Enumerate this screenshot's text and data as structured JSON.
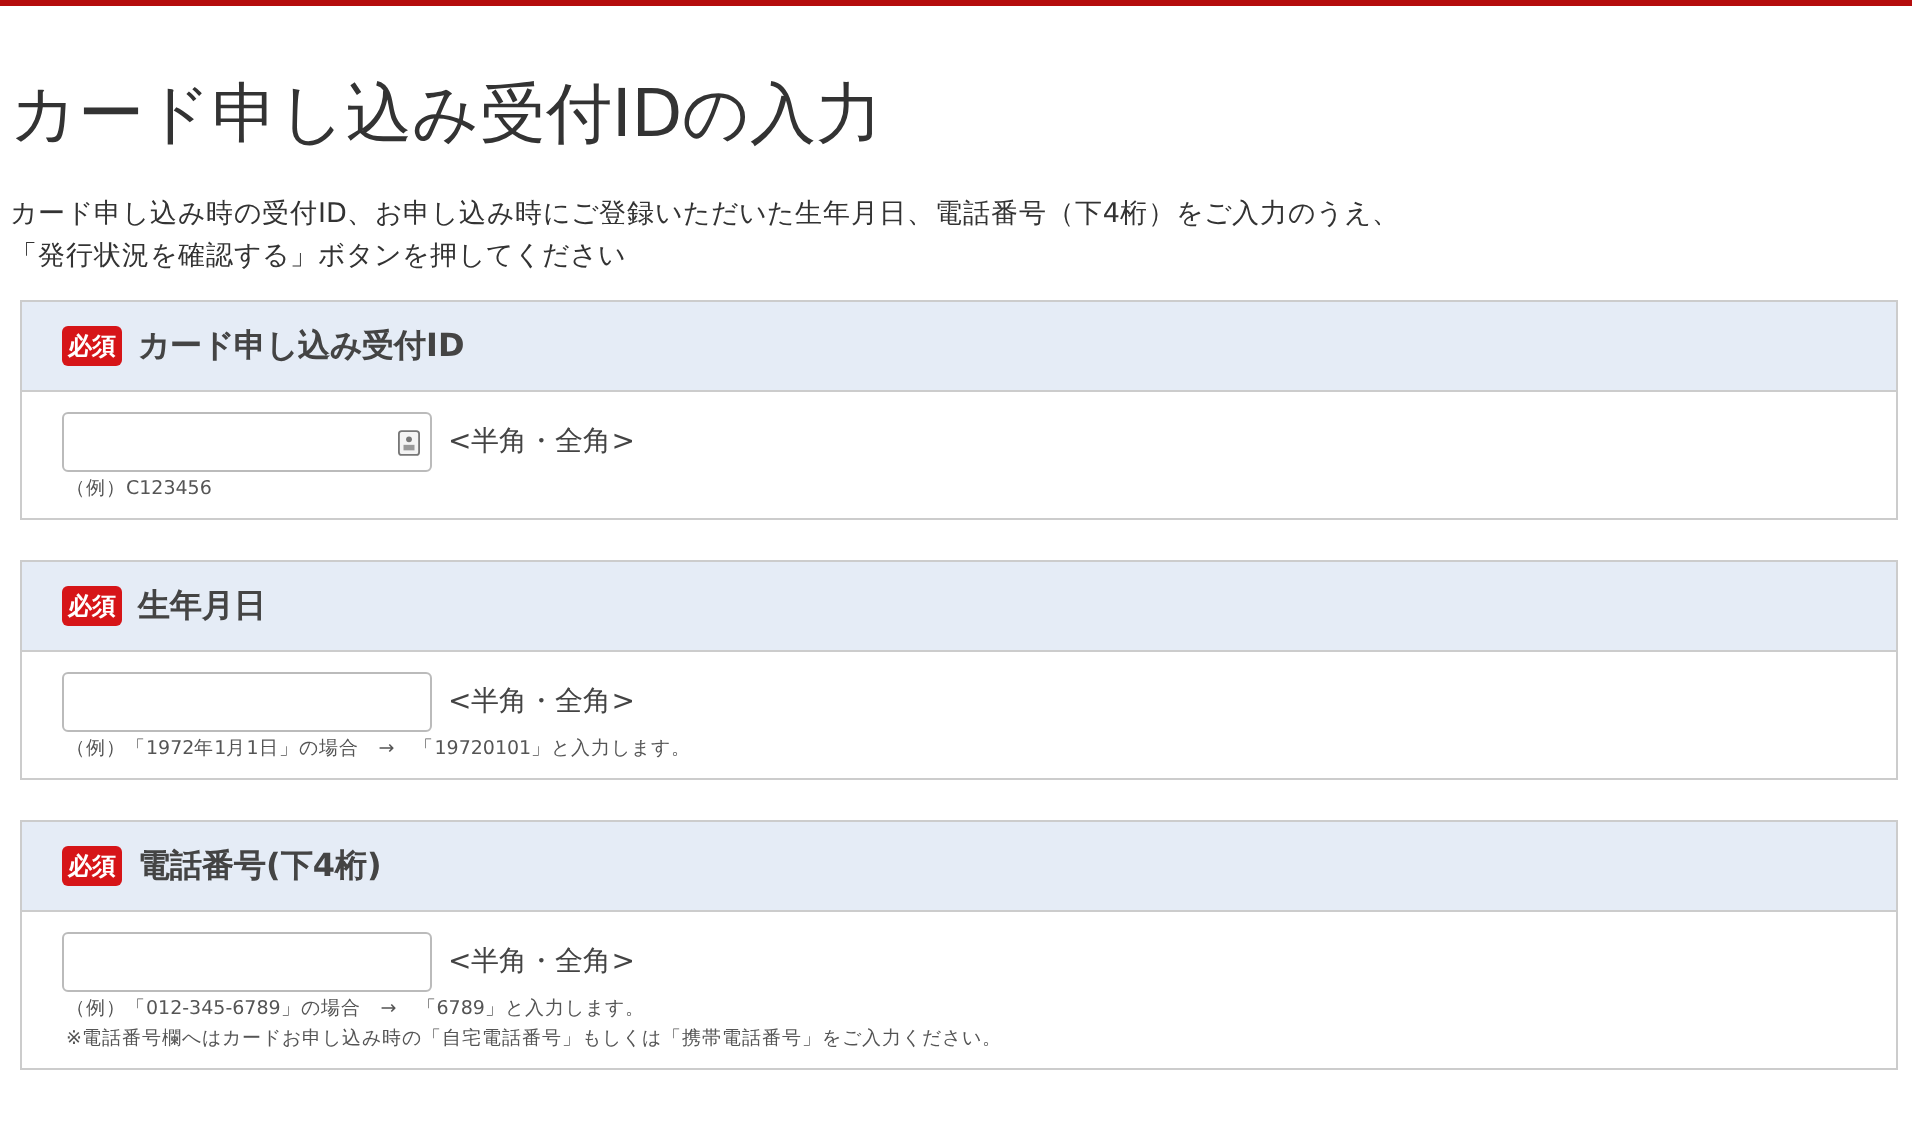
{
  "title": "カード申し込み受付IDの入力",
  "intro": [
    "カード申し込み時の受付ID、お申し込み時にご登録いただいた生年月日、電話番号（下4桁）をご入力のうえ、",
    "「発行状況を確認する」ボタンを押してください"
  ],
  "sections": [
    {
      "badge": "必須",
      "label": "カード申し込み受付ID",
      "field_icon": true,
      "hint": "<半角・全角>",
      "notes": [
        "（例）C123456"
      ]
    },
    {
      "badge": "必須",
      "label": "生年月日",
      "field_icon": false,
      "hint": "<半角・全角>",
      "notes": [
        "（例）「1972年1月1日」の場合　→　「19720101」と入力します。"
      ]
    },
    {
      "badge": "必須",
      "label": "電話番号(下4桁)",
      "field_icon": false,
      "hint": "<半角・全角>",
      "notes": [
        "（例）「012-345-6789」の場合　→　「6789」と入力します。",
        "※電話番号欄へはカードお申し込み時の「自宅電話番号」もしくは「携帯電話番号」をご入力ください。"
      ]
    }
  ]
}
